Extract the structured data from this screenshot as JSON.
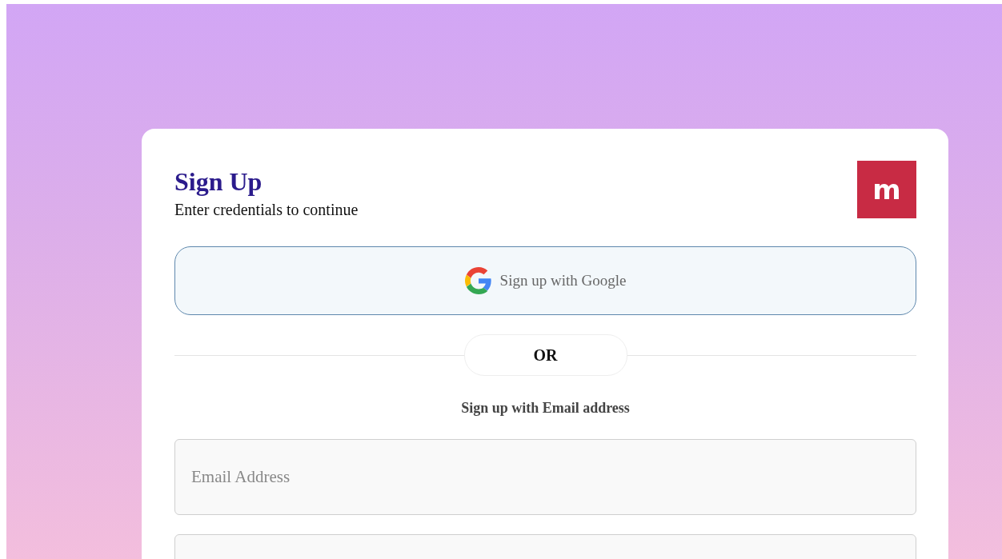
{
  "card": {
    "title": "Sign Up",
    "subtitle": "Enter credentials to continue",
    "logo": "m"
  },
  "google_button": {
    "label": "Sign up with Google"
  },
  "divider": {
    "label": "OR"
  },
  "email_heading": "Sign up with Email address",
  "fields": [
    {
      "placeholder": "Email Address"
    }
  ]
}
